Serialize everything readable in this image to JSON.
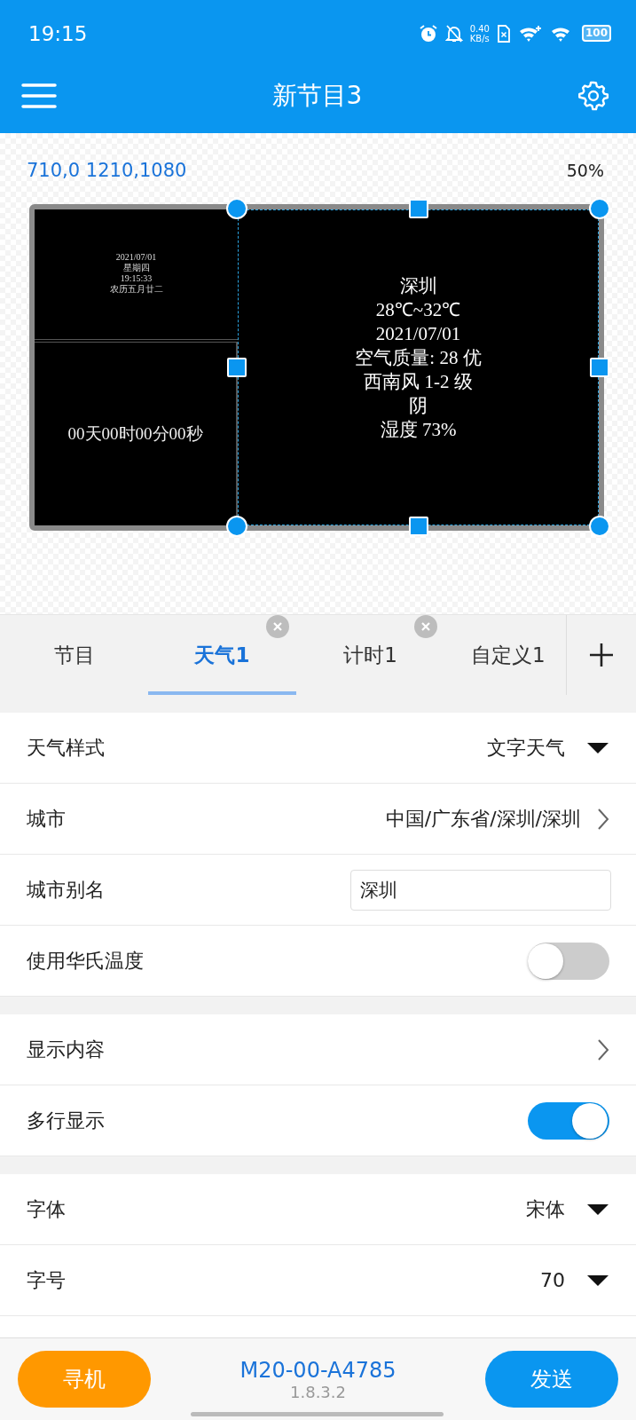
{
  "status_bar": {
    "time": "19:15",
    "speed_value": "0.40",
    "speed_unit": "KB/s",
    "battery": "100"
  },
  "header": {
    "title": "新节目3"
  },
  "canvas": {
    "coords": "710,0 1210,1080",
    "zoom": "50%",
    "clock_lines": [
      "2021/07/01",
      "星期四",
      "19:15:33",
      "农历五月廿二"
    ],
    "timer_text": "00天00时00分00秒",
    "weather_lines": [
      "深圳",
      "28℃~32℃",
      "2021/07/01",
      "空气质量: 28 优",
      "西南风 1-2 级",
      "阴",
      "湿度 73%"
    ]
  },
  "tabs": [
    {
      "label": "节目",
      "selected": false,
      "closable": false
    },
    {
      "label": "天气1",
      "selected": true,
      "closable": true
    },
    {
      "label": "计时1",
      "selected": false,
      "closable": true
    },
    {
      "label": "自定义1",
      "selected": false,
      "closable": false
    }
  ],
  "settings": [
    [
      {
        "kind": "dropdown",
        "label": "天气样式",
        "value": "文字天气"
      },
      {
        "kind": "link",
        "label": "城市",
        "value": "中国/广东省/深圳/深圳"
      },
      {
        "kind": "input",
        "label": "城市别名",
        "value": "深圳"
      },
      {
        "kind": "toggle",
        "label": "使用华氏温度",
        "on": false
      }
    ],
    [
      {
        "kind": "link",
        "label": "显示内容"
      },
      {
        "kind": "toggle",
        "label": "多行显示",
        "on": true
      }
    ],
    [
      {
        "kind": "dropdown",
        "label": "字体",
        "value": "宋体"
      },
      {
        "kind": "dropdown",
        "label": "字号",
        "value": "70"
      }
    ]
  ],
  "bottom_bar": {
    "left_button": "寻机",
    "device": "M20-00-A4785",
    "version": "1.8.3.2",
    "right_button": "发送"
  }
}
